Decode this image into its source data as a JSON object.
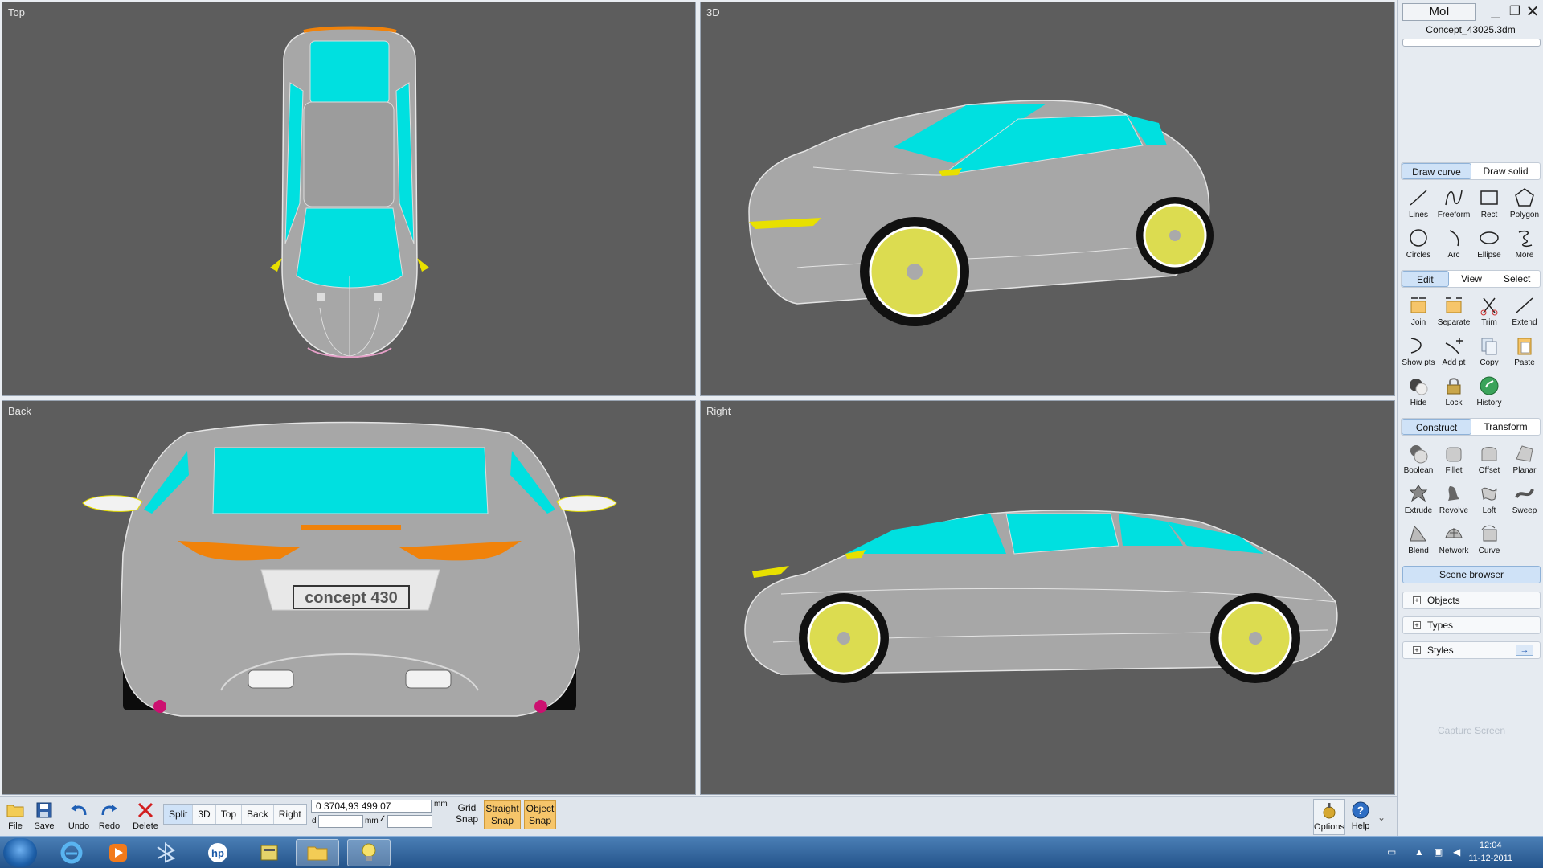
{
  "window": {
    "app_label": "MoI",
    "filename": "Concept_43025.3dm",
    "minimize_label": "_",
    "restore_label": "❐",
    "close_label": "✕"
  },
  "viewports": [
    {
      "title": "Top"
    },
    {
      "title": "3D"
    },
    {
      "title": "Back"
    },
    {
      "title": "Right"
    }
  ],
  "car": {
    "plate_text": "concept 430",
    "colors": {
      "body": "#a7a7a7",
      "glass": "#00e0e0",
      "light": "#f0820a",
      "wheel_hub": "#e8e000"
    }
  },
  "draw_tabs": {
    "tabs": [
      {
        "label": "Draw curve"
      },
      {
        "label": "Draw solid"
      }
    ],
    "tools": [
      {
        "label": "Lines",
        "icon": "lines-icon"
      },
      {
        "label": "Freeform",
        "icon": "freeform-icon"
      },
      {
        "label": "Rect",
        "icon": "rect-icon"
      },
      {
        "label": "Polygon",
        "icon": "polygon-icon"
      },
      {
        "label": "Circles",
        "icon": "circle-icon"
      },
      {
        "label": "Arc",
        "icon": "arc-icon"
      },
      {
        "label": "Ellipse",
        "icon": "ellipse-icon"
      },
      {
        "label": "More",
        "icon": "more-icon"
      }
    ]
  },
  "edit_tabs": {
    "tabs": [
      {
        "label": "Edit"
      },
      {
        "label": "View"
      },
      {
        "label": "Select"
      }
    ],
    "tools": [
      {
        "label": "Join",
        "icon": "join-icon"
      },
      {
        "label": "Separate",
        "icon": "separate-icon"
      },
      {
        "label": "Trim",
        "icon": "trim-icon"
      },
      {
        "label": "Extend",
        "icon": "extend-icon"
      },
      {
        "label": "Show pts",
        "icon": "show-points-icon"
      },
      {
        "label": "Add pt",
        "icon": "add-point-icon"
      },
      {
        "label": "Copy",
        "icon": "copy-icon"
      },
      {
        "label": "Paste",
        "icon": "paste-icon"
      },
      {
        "label": "Hide",
        "icon": "hide-icon"
      },
      {
        "label": "Lock",
        "icon": "lock-icon"
      },
      {
        "label": "History",
        "icon": "history-icon"
      }
    ]
  },
  "construct_tabs": {
    "tabs": [
      {
        "label": "Construct"
      },
      {
        "label": "Transform"
      }
    ],
    "tools": [
      {
        "label": "Boolean",
        "icon": "boolean-icon"
      },
      {
        "label": "Fillet",
        "icon": "fillet-icon"
      },
      {
        "label": "Offset",
        "icon": "offset-icon"
      },
      {
        "label": "Planar",
        "icon": "planar-icon"
      },
      {
        "label": "Extrude",
        "icon": "extrude-icon"
      },
      {
        "label": "Revolve",
        "icon": "revolve-icon"
      },
      {
        "label": "Loft",
        "icon": "loft-icon"
      },
      {
        "label": "Sweep",
        "icon": "sweep-icon"
      },
      {
        "label": "Blend",
        "icon": "blend-icon"
      },
      {
        "label": "Network",
        "icon": "network-icon"
      },
      {
        "label": "Curve",
        "icon": "curve-icon"
      }
    ]
  },
  "scene_browser": {
    "title": "Scene browser",
    "items": [
      {
        "label": "Objects"
      },
      {
        "label": "Types"
      },
      {
        "label": "Styles"
      }
    ],
    "plus": "+",
    "arrow": "→"
  },
  "capture_label": "Capture Screen",
  "toolbar": {
    "file": "File",
    "save": "Save",
    "undo": "Undo",
    "redo": "Redo",
    "delete": "Delete",
    "views": [
      {
        "label": "Split"
      },
      {
        "label": "3D"
      },
      {
        "label": "Top"
      },
      {
        "label": "Back"
      },
      {
        "label": "Right"
      }
    ],
    "coords": "0      3704,93  499,07",
    "unit_mm": "mm",
    "d_label": "d",
    "grid_snap": "Grid Snap",
    "straight_snap": "Straight Snap",
    "object_snap": "Object Snap",
    "options": "Options",
    "help": "Help"
  },
  "taskbar": {
    "time": "12:04",
    "date": "11-12-2011"
  }
}
